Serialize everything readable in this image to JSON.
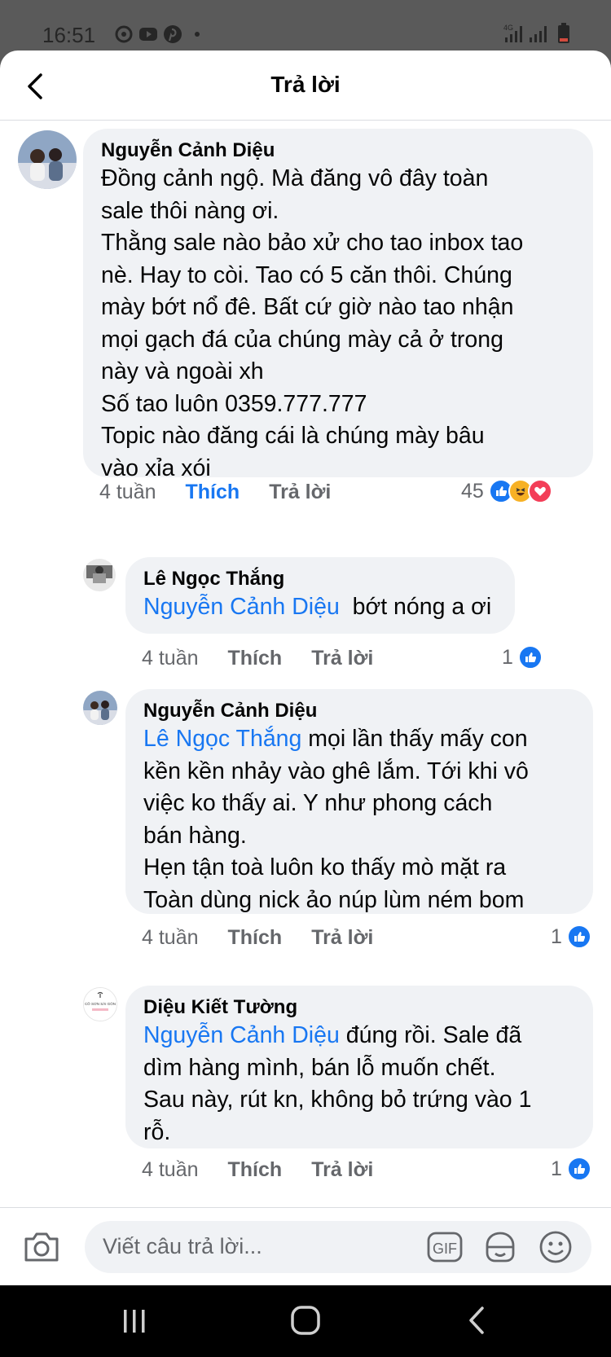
{
  "status": {
    "time": "16:51",
    "network": "4G"
  },
  "header": {
    "title": "Trả lời",
    "back_icon": "chevron-left-icon"
  },
  "comments": [
    {
      "author": "Nguyễn Cảnh Diệu",
      "lines": [
        "Đồng cảnh ngộ. Mà đăng vô đây toàn",
        "sale thôi nàng ơi.",
        "Thằng sale nào bảo xử cho tao inbox tao",
        "nè. Hay to còi. Tao có 5 căn thôi. Chúng",
        "mày bớt nổ đê. Bất cứ giờ nào tao nhận",
        "mọi gạch đá của chúng mày cả ở trong",
        "này và ngoài xh",
        "Số tao luôn 0359.777.777",
        "Topic nào đăng cái là chúng mày bâu",
        "vào xỉa xói"
      ],
      "time": "4 tuần",
      "like": "Thích",
      "reply": "Trả lời",
      "reaction_count": "45"
    },
    {
      "author": "Lê Ngọc Thắng",
      "mention": "Nguyễn Cảnh Diệu",
      "text": "bớt nóng a ơi",
      "time": "4 tuần",
      "like": "Thích",
      "reply": "Trả lời",
      "reaction_count": "1"
    },
    {
      "author": "Nguyễn Cảnh Diệu",
      "mention": "Lê Ngọc Thắng",
      "first_line": "mọi lần thấy mấy con",
      "lines": [
        "kền kền nhảy vào ghê lắm. Tới khi vô",
        "việc ko thấy ai. Y như phong cách",
        "bán hàng.",
        "Hẹn tận toà luôn ko thấy mò mặt ra",
        "Toàn dùng nick ảo núp lùm ném bom"
      ],
      "time": "4 tuần",
      "like": "Thích",
      "reply": "Trả lời",
      "reaction_count": "1"
    },
    {
      "author": "Diệu Kiết Tường",
      "mention": "Nguyễn Cảnh Diệu",
      "first_line": "đúng rồi. Sale đã",
      "lines": [
        "dìm hàng mình, bán lỗ muốn chết.",
        "Sau này, rút kn, không bỏ trứng vào 1",
        "rỗ."
      ],
      "avatar_text": "CÔ SƠN SÀI GÒN",
      "time": "4 tuần",
      "like": "Thích",
      "reply": "Trả lời",
      "reaction_count": "1"
    }
  ],
  "composer": {
    "placeholder": "Viết câu trả lời...",
    "gif_label": "GIF",
    "icons": [
      "camera-icon",
      "gif-icon",
      "sticker-icon",
      "emoji-icon"
    ]
  },
  "colors": {
    "accent": "#1877f2",
    "bubble": "#f0f2f5",
    "muted": "#65676b"
  }
}
